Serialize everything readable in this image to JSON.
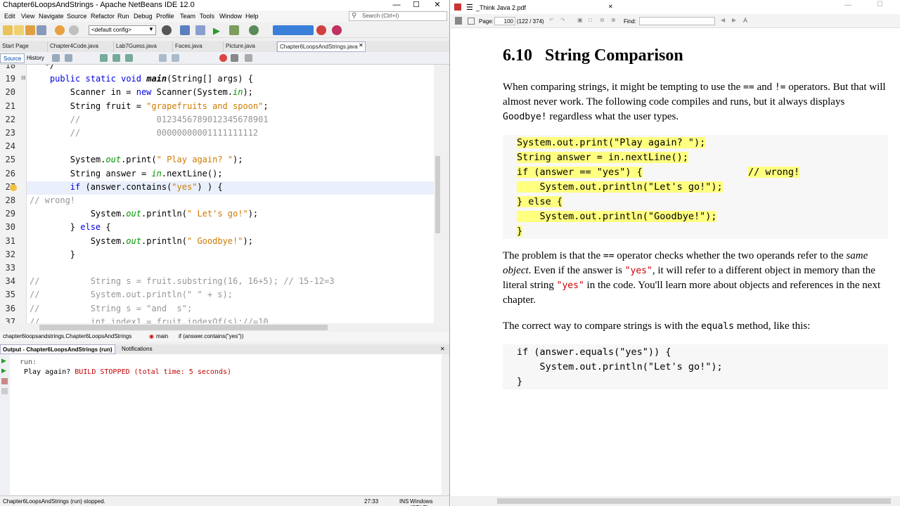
{
  "ide": {
    "window_title": "Chapter6LoopsAndStrings - Apache NetBeans IDE 12.0",
    "menu": [
      "Edit",
      "View",
      "Navigate",
      "Source",
      "Refactor",
      "Run",
      "Debug",
      "Profile",
      "Team",
      "Tools",
      "Window",
      "Help"
    ],
    "search_placeholder": "Search (Ctrl+I)",
    "config": "<default config>",
    "file_tabs": [
      "Start Page",
      "Chapter4Code.java",
      "Lab7Guess.java",
      "Faces.java",
      "Picture.java",
      "Chapter6LoopsAndStrings.java"
    ],
    "active_file_tab": "Chapter6LoopsAndStrings.java",
    "source_tab": "Source",
    "history_tab": "History",
    "code_lines": [
      {
        "n": "18",
        "text": "   */"
      },
      {
        "n": "19",
        "text": "    public static void main(String[] args) {"
      },
      {
        "n": "20",
        "text": "        Scanner in = new Scanner(System.in);"
      },
      {
        "n": "21",
        "text": "        String fruit = \"grapefruits and spoon\";"
      },
      {
        "n": "22",
        "text": "        //               0123456789012345678901"
      },
      {
        "n": "23",
        "text": "        //               00000000001111111112"
      },
      {
        "n": "24",
        "text": ""
      },
      {
        "n": "25",
        "text": "        System.out.print(\" Play again? \");"
      },
      {
        "n": "26",
        "text": "        String answer = in.nextLine();"
      },
      {
        "n": "27",
        "text": "        if (answer.contains(\"yes\") ) {"
      },
      {
        "n": "28",
        "text": "// wrong!"
      },
      {
        "n": "29",
        "text": "            System.out.println(\" Let's go!\");"
      },
      {
        "n": "30",
        "text": "        } else {"
      },
      {
        "n": "31",
        "text": "            System.out.println(\" Goodbye!\");"
      },
      {
        "n": "32",
        "text": "        }"
      },
      {
        "n": "33",
        "text": ""
      },
      {
        "n": "34",
        "text": "//          String s = fruit.substring(16, 16+5); // 15-12=3"
      },
      {
        "n": "35",
        "text": "//          System.out.println(\" \" + s);"
      },
      {
        "n": "36",
        "text": "//          String s = \"and  s\";"
      },
      {
        "n": "37",
        "text": "//          int index1 = fruit.indexOf(s);//=10"
      }
    ],
    "breadcrumb": [
      "chapter6loopsandstrings.Chapter6LoopsAndStrings",
      "main",
      "if (answer.contains(\"yes\"))"
    ],
    "output_tab": "Output - Chapter6LoopsAndStrings (run)",
    "notifications_tab": "Notifications",
    "output_run": "run:",
    "output_prompt": "Play again? ",
    "output_build": "BUILD STOPPED (total time: 5 seconds)",
    "status_left": "Chapter6LoopsAndStrings (run) stopped.",
    "status_pos": "27:33",
    "status_mode": "INS",
    "status_eol": "Windows (CRLF)"
  },
  "pdf": {
    "title": "_Think Java 2.pdf",
    "page_label": "Page:",
    "page_value": "100",
    "page_info": "(122 / 374)",
    "find_label": "Find:",
    "heading_number": "6.10",
    "heading_text": "String Comparison",
    "p1": [
      "When comparing strings, it might be tempting to use the ",
      "==",
      " and ",
      "!=",
      " operators. But that will almost never work. The following code compiles and runs, but it always displays ",
      "Goodbye!",
      " regardless what the user types."
    ],
    "code1": [
      "System.out.print(\"Play again? \");",
      "String answer = in.nextLine();",
      "if (answer == \"yes\") {",
      "    System.out.println(\"Let's go!\");",
      "} else {",
      "    System.out.println(\"Goodbye!\");",
      "}"
    ],
    "code1_comment": "// wrong!",
    "p2": [
      "The problem is that the ",
      "==",
      " operator checks whether the two operands refer to the ",
      "same object",
      ". Even if the answer is ",
      "\"yes\"",
      ", it will refer to a different object in memory than the literal string ",
      "\"yes\"",
      " in the code. You'll learn more about objects and references in the next chapter."
    ],
    "p3": [
      "The correct way to compare strings is with the ",
      "equals",
      " method, like this:"
    ],
    "code2": [
      "if (answer.equals(\"yes\")) {",
      "    System.out.println(\"Let's go!\");",
      "}"
    ]
  }
}
